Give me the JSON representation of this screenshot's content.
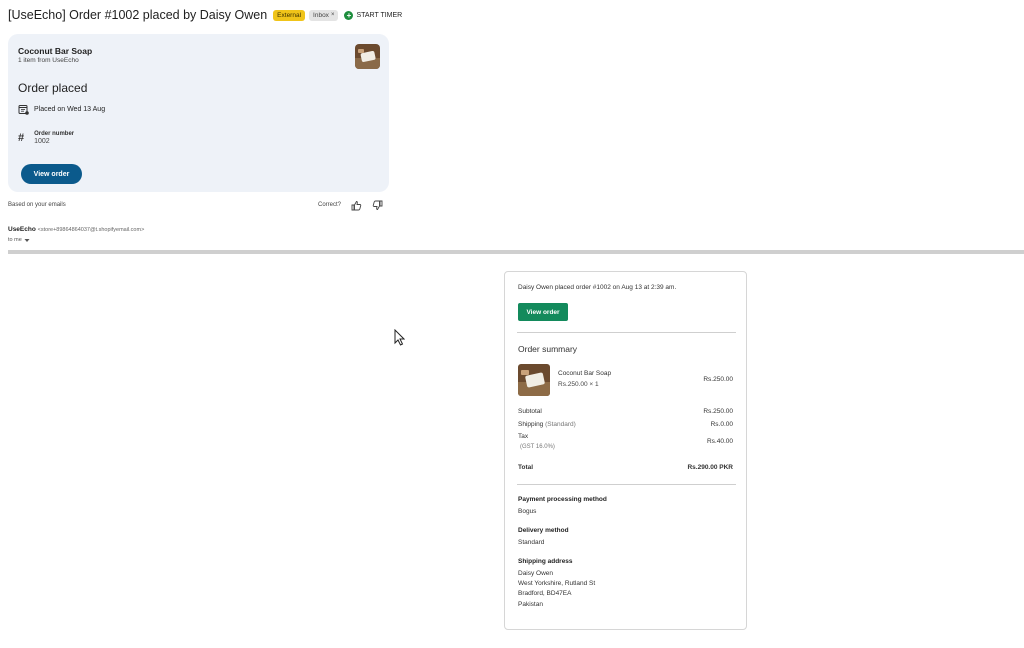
{
  "header": {
    "subject": "[UseEcho] Order #1002 placed by Daisy Owen",
    "external_label": "External",
    "inbox_label": "Inbox",
    "timer_label": "START TIMER"
  },
  "card": {
    "product_name": "Coconut Bar Soap",
    "items_from": "1 item from UseEcho",
    "status": "Order placed",
    "placed_text": "Placed on Wed 13 Aug",
    "order_number_label": "Order number",
    "order_number_value": "1002",
    "view_order_label": "View order"
  },
  "feedback": {
    "based_text": "Based on your emails",
    "correct_text": "Correct?"
  },
  "sender": {
    "name": "UseEcho",
    "email": "<store+89864864037@t.shopifyemail.com>",
    "to": "to me"
  },
  "email": {
    "intro": "Daisy Owen placed order #1002 on Aug 13 at 2:39 am.",
    "view_order_label": "View order",
    "summary_title": "Order summary",
    "item": {
      "name": "Coconut Bar Soap",
      "qty_price": "Rs.250.00 × 1",
      "line_total": "Rs.250.00"
    },
    "subtotal_label": "Subtotal",
    "subtotal_value": "Rs.250.00",
    "shipping_label": "Shipping",
    "shipping_method": "(Standard)",
    "shipping_value": "Rs.0.00",
    "tax_label": "Tax",
    "tax_detail": "(GST 16.0%)",
    "tax_value": "Rs.40.00",
    "total_label": "Total",
    "total_value": "Rs.290.00 PKR",
    "payment_heading": "Payment processing method",
    "payment_value": "Bogus",
    "delivery_heading": "Delivery method",
    "delivery_value": "Standard",
    "address_heading": "Shipping address",
    "address_lines": [
      "Daisy Owen",
      "West Yorkshire, Rutland St",
      "Bradford, BD47EA",
      "Pakistan"
    ]
  },
  "colors": {
    "card_bg": "#eef2f8",
    "card_button": "#0b5a8c",
    "email_button": "#138a5c",
    "external_badge": "#f0c419"
  }
}
